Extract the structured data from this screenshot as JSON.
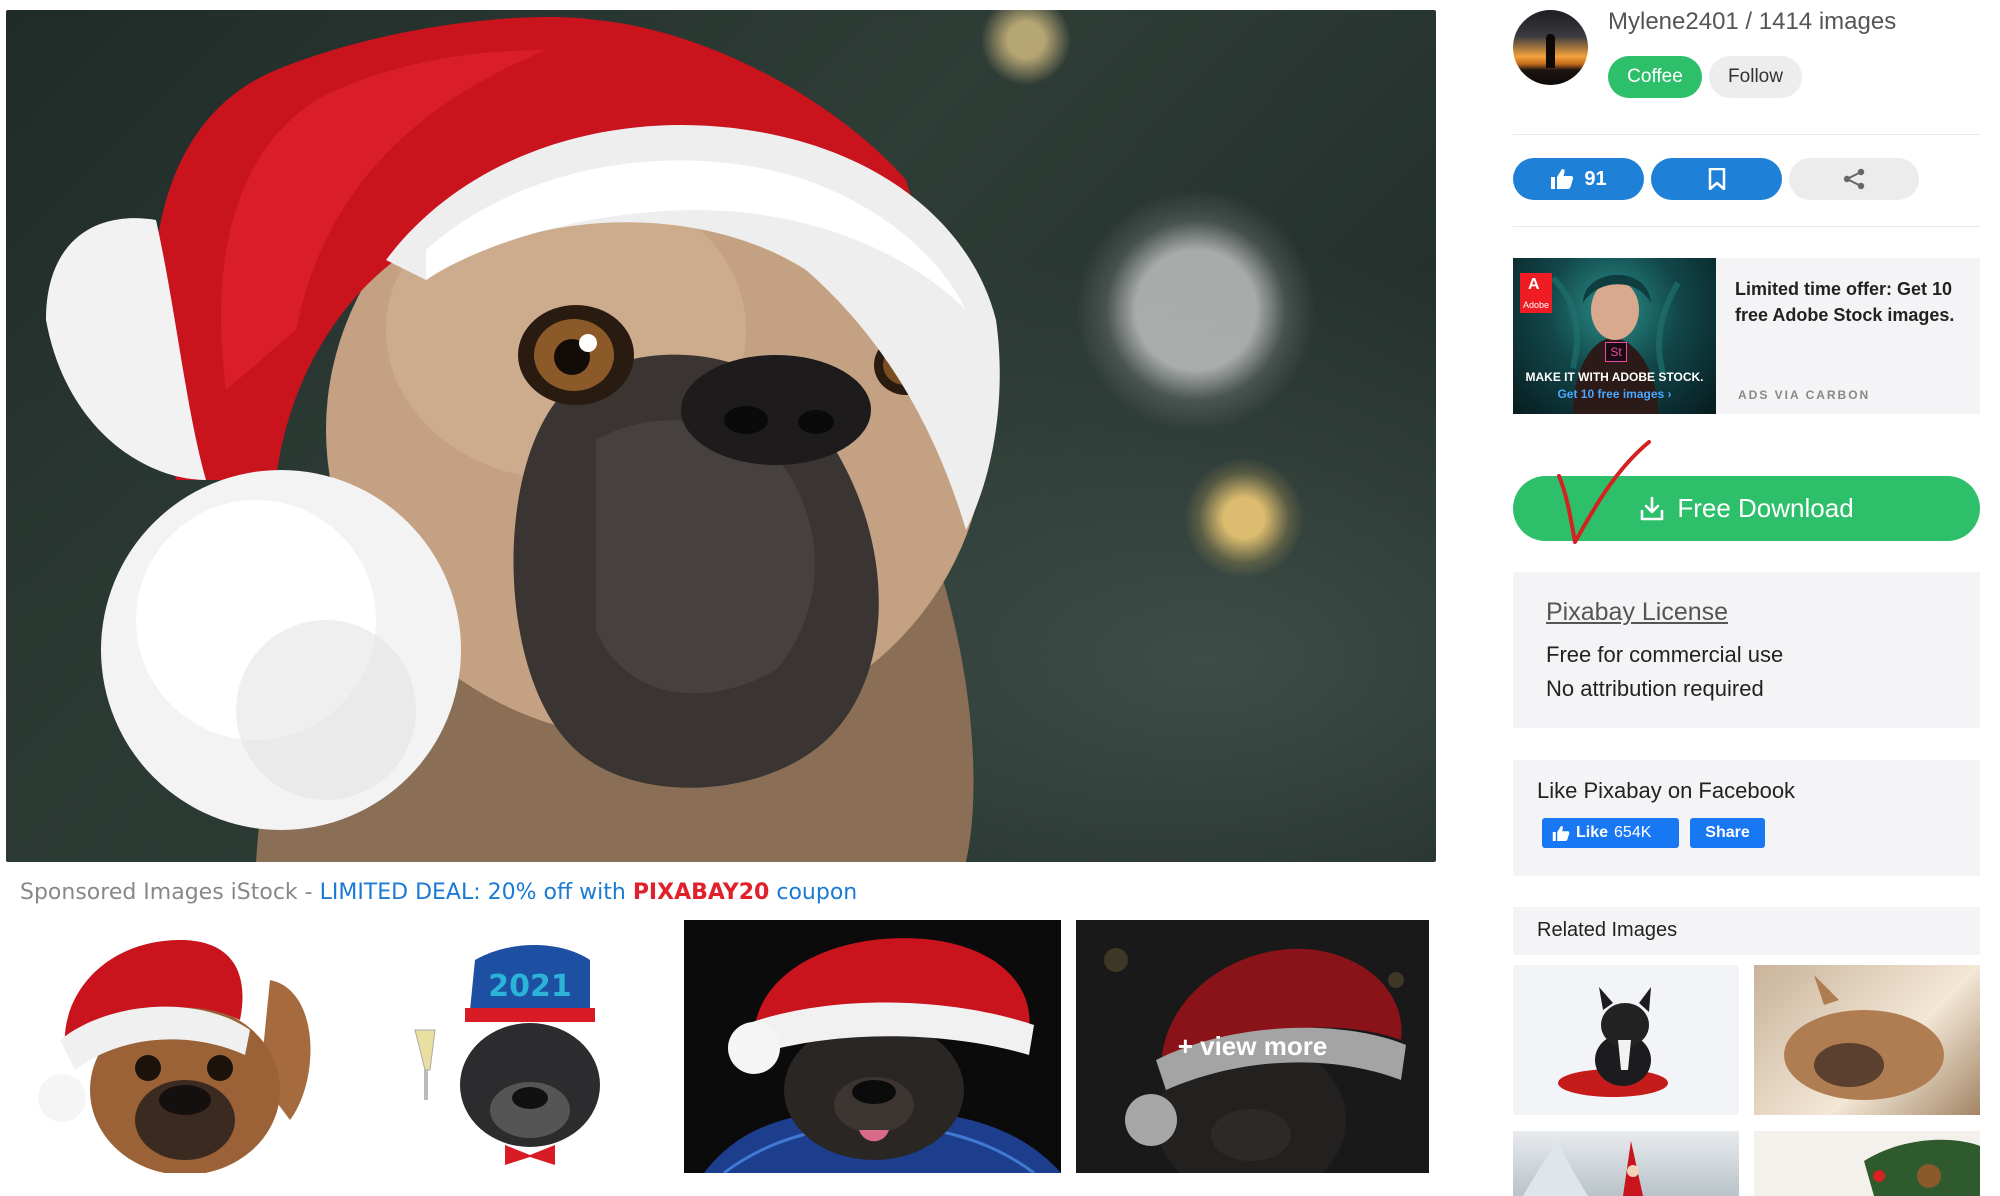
{
  "main_image": {
    "alt": "French bulldog wearing a Santa hat"
  },
  "sponsored": {
    "prefix": "Sponsored Images iStock - ",
    "deal": "LIMITED DEAL: 20% off with ",
    "code": "PIXABAY20",
    "suffix": " coupon",
    "view_more_label": "+ view more"
  },
  "author": {
    "name_line": "Mylene2401 / 1414 images",
    "coffee_label": "Coffee",
    "follow_label": "Follow"
  },
  "actions": {
    "like_count": "91",
    "like_icon": "thumbs-up-icon",
    "save_icon": "bookmark-icon",
    "share_icon": "share-icon"
  },
  "ad": {
    "logo_text": "Adobe",
    "st_badge": "St",
    "image_line1": "MAKE IT WITH ADOBE STOCK.",
    "image_line2": "Get 10 free images ›",
    "text": "Limited time offer: Get 10 free Adobe Stock images.",
    "via": "ADS VIA CARBON"
  },
  "download": {
    "label": "Free Download",
    "icon": "download-icon"
  },
  "license": {
    "title": "Pixabay License",
    "line1": "Free for commercial use",
    "line2": "No attribution required"
  },
  "facebook": {
    "title": "Like Pixabay on Facebook",
    "like_label": "Like",
    "like_count": "654K",
    "share_label": "Share"
  },
  "related": {
    "title": "Related Images"
  },
  "colors": {
    "green": "#2ebf6a",
    "blue": "#1f80d8",
    "facebook_blue": "#1877f2",
    "deal_blue": "#1a7ad4",
    "coupon_red": "#e0202a",
    "panel_gray": "#f4f4f6"
  }
}
